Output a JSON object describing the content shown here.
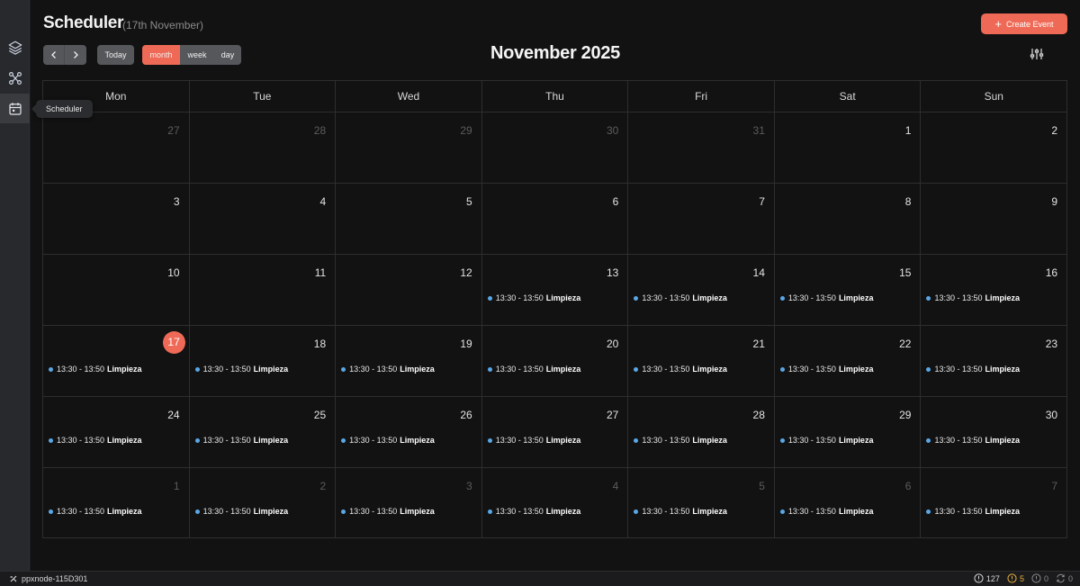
{
  "sidebar": {
    "items": [
      {
        "icon": "layers-icon",
        "label": "Layers"
      },
      {
        "icon": "workflow-icon",
        "label": "Workflows"
      },
      {
        "icon": "calendar-icon",
        "label": "Scheduler"
      }
    ],
    "tooltip": "Scheduler"
  },
  "header": {
    "title": "Scheduler",
    "subtitle": "(17th November)",
    "create_label": "Create Event",
    "today_label": "Today",
    "views": [
      "month",
      "week",
      "day"
    ],
    "active_view": "month",
    "month_title": "November 2025"
  },
  "calendar": {
    "weekdays": [
      "Mon",
      "Tue",
      "Wed",
      "Thu",
      "Fri",
      "Sat",
      "Sun"
    ],
    "event_color": "#5aa7e6",
    "today_color": "#ee6a56",
    "weeks": [
      [
        {
          "day": "27",
          "other": true,
          "event": null
        },
        {
          "day": "28",
          "other": true,
          "event": null
        },
        {
          "day": "29",
          "other": true,
          "event": null
        },
        {
          "day": "30",
          "other": true,
          "event": null
        },
        {
          "day": "31",
          "other": true,
          "event": null
        },
        {
          "day": "1",
          "other": false,
          "event": null
        },
        {
          "day": "2",
          "other": false,
          "event": null
        }
      ],
      [
        {
          "day": "3",
          "other": false,
          "event": null
        },
        {
          "day": "4",
          "other": false,
          "event": null
        },
        {
          "day": "5",
          "other": false,
          "event": null
        },
        {
          "day": "6",
          "other": false,
          "event": null
        },
        {
          "day": "7",
          "other": false,
          "event": null
        },
        {
          "day": "8",
          "other": false,
          "event": null
        },
        {
          "day": "9",
          "other": false,
          "event": null
        }
      ],
      [
        {
          "day": "10",
          "other": false,
          "event": null
        },
        {
          "day": "11",
          "other": false,
          "event": null
        },
        {
          "day": "12",
          "other": false,
          "event": null
        },
        {
          "day": "13",
          "other": false,
          "event": {
            "time": "13:30 - 13:50",
            "title": "Limpieza"
          }
        },
        {
          "day": "14",
          "other": false,
          "event": {
            "time": "13:30 - 13:50",
            "title": "Limpieza"
          }
        },
        {
          "day": "15",
          "other": false,
          "event": {
            "time": "13:30 - 13:50",
            "title": "Limpieza"
          }
        },
        {
          "day": "16",
          "other": false,
          "event": {
            "time": "13:30 - 13:50",
            "title": "Limpieza"
          }
        }
      ],
      [
        {
          "day": "17",
          "other": false,
          "today": true,
          "event": {
            "time": "13:30 - 13:50",
            "title": "Limpieza"
          }
        },
        {
          "day": "18",
          "other": false,
          "event": {
            "time": "13:30 - 13:50",
            "title": "Limpieza"
          }
        },
        {
          "day": "19",
          "other": false,
          "event": {
            "time": "13:30 - 13:50",
            "title": "Limpieza"
          }
        },
        {
          "day": "20",
          "other": false,
          "event": {
            "time": "13:30 - 13:50",
            "title": "Limpieza"
          }
        },
        {
          "day": "21",
          "other": false,
          "event": {
            "time": "13:30 - 13:50",
            "title": "Limpieza"
          }
        },
        {
          "day": "22",
          "other": false,
          "event": {
            "time": "13:30 - 13:50",
            "title": "Limpieza"
          }
        },
        {
          "day": "23",
          "other": false,
          "event": {
            "time": "13:30 - 13:50",
            "title": "Limpieza"
          }
        }
      ],
      [
        {
          "day": "24",
          "other": false,
          "event": {
            "time": "13:30 - 13:50",
            "title": "Limpieza"
          }
        },
        {
          "day": "25",
          "other": false,
          "event": {
            "time": "13:30 - 13:50",
            "title": "Limpieza"
          }
        },
        {
          "day": "26",
          "other": false,
          "event": {
            "time": "13:30 - 13:50",
            "title": "Limpieza"
          }
        },
        {
          "day": "27",
          "other": false,
          "event": {
            "time": "13:30 - 13:50",
            "title": "Limpieza"
          }
        },
        {
          "day": "28",
          "other": false,
          "event": {
            "time": "13:30 - 13:50",
            "title": "Limpieza"
          }
        },
        {
          "day": "29",
          "other": false,
          "event": {
            "time": "13:30 - 13:50",
            "title": "Limpieza"
          }
        },
        {
          "day": "30",
          "other": false,
          "event": {
            "time": "13:30 - 13:50",
            "title": "Limpieza"
          }
        }
      ],
      [
        {
          "day": "1",
          "other": true,
          "event": {
            "time": "13:30 - 13:50",
            "title": "Limpieza"
          }
        },
        {
          "day": "2",
          "other": true,
          "event": {
            "time": "13:30 - 13:50",
            "title": "Limpieza"
          }
        },
        {
          "day": "3",
          "other": true,
          "event": {
            "time": "13:30 - 13:50",
            "title": "Limpieza"
          }
        },
        {
          "day": "4",
          "other": true,
          "event": {
            "time": "13:30 - 13:50",
            "title": "Limpieza"
          }
        },
        {
          "day": "5",
          "other": true,
          "event": {
            "time": "13:30 - 13:50",
            "title": "Limpieza"
          }
        },
        {
          "day": "6",
          "other": true,
          "event": {
            "time": "13:30 - 13:50",
            "title": "Limpieza"
          }
        },
        {
          "day": "7",
          "other": true,
          "event": {
            "time": "13:30 - 13:50",
            "title": "Limpieza"
          }
        }
      ]
    ]
  },
  "statusbar": {
    "node": "ppxnode-115D301",
    "info_count": "127",
    "warning_count": "5",
    "error_count": "0",
    "sync_count": "0"
  }
}
